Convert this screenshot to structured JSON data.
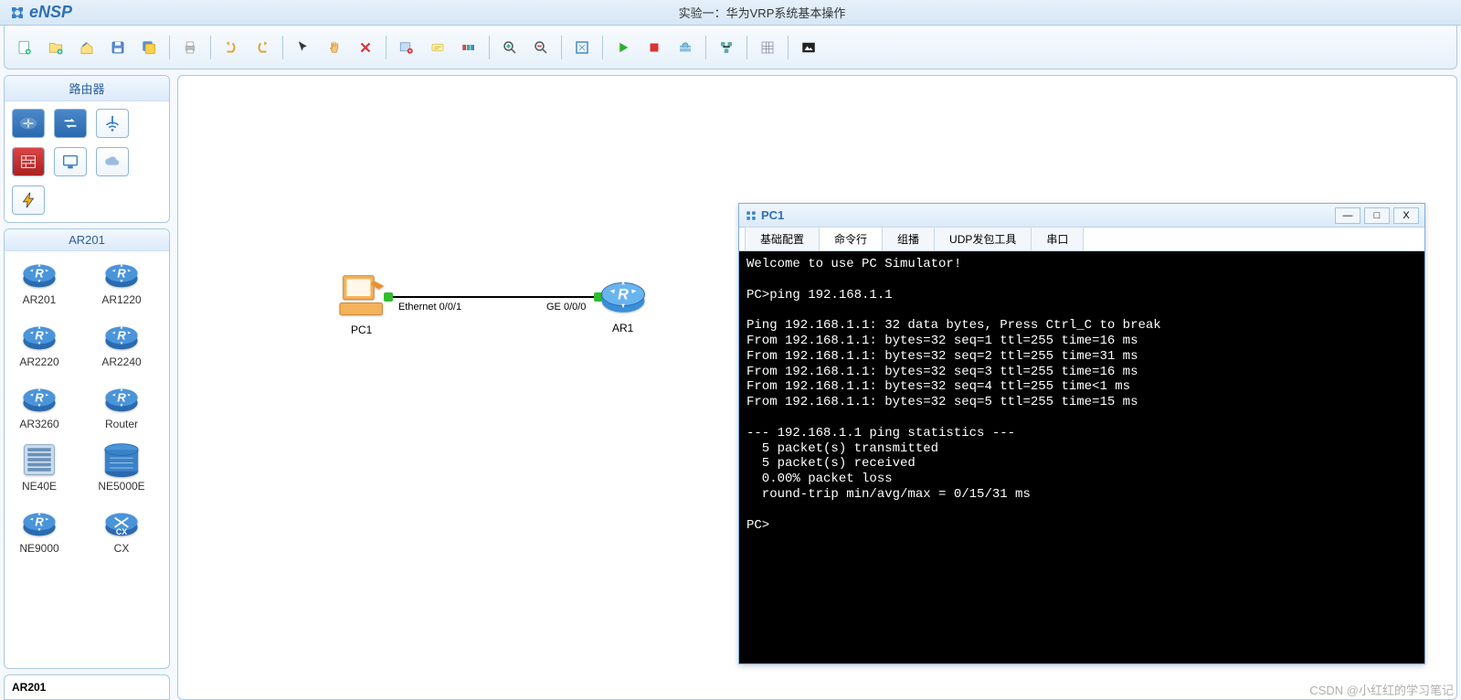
{
  "app": {
    "name": "eNSP",
    "document_title": "实验一：华为VRP系统基本操作"
  },
  "toolbar_icons": [
    "new",
    "open",
    "up",
    "save",
    "saveall",
    "export",
    "print",
    "undo",
    "redo",
    "select",
    "pan",
    "delete",
    "edit-device",
    "note",
    "zoom-area",
    "zoom-in",
    "zoom-out",
    "screenshot",
    "start",
    "stop",
    "capture",
    "settings",
    "grid",
    "theme"
  ],
  "sidebar": {
    "category_title": "路由器",
    "category_icons": [
      "router-cat",
      "switch-cat",
      "wlan-cat",
      "firewall-cat",
      "pc-cat",
      "cloud-cat",
      "lightning-cat"
    ],
    "group_title": "AR201",
    "devices": [
      {
        "label": "AR201",
        "icon": "router"
      },
      {
        "label": "AR1220",
        "icon": "router"
      },
      {
        "label": "AR2220",
        "icon": "router"
      },
      {
        "label": "AR2240",
        "icon": "router"
      },
      {
        "label": "AR3260",
        "icon": "router"
      },
      {
        "label": "Router",
        "icon": "router"
      },
      {
        "label": "NE40E",
        "icon": "ne40e"
      },
      {
        "label": "NE5000E",
        "icon": "ne5000e"
      },
      {
        "label": "NE9000",
        "icon": "router"
      },
      {
        "label": "CX",
        "icon": "cx"
      }
    ],
    "preview_label": "AR201"
  },
  "topology": {
    "pc_label": "PC1",
    "if_left": "Ethernet 0/0/1",
    "if_right": "GE 0/0/0",
    "router_label": "AR1"
  },
  "terminal": {
    "title": "PC1",
    "tabs": [
      "基础配置",
      "命令行",
      "组播",
      "UDP发包工具",
      "串口"
    ],
    "active_tab": 1,
    "output": "Welcome to use PC Simulator!\n\nPC>ping 192.168.1.1\n\nPing 192.168.1.1: 32 data bytes, Press Ctrl_C to break\nFrom 192.168.1.1: bytes=32 seq=1 ttl=255 time=16 ms\nFrom 192.168.1.1: bytes=32 seq=2 ttl=255 time=31 ms\nFrom 192.168.1.1: bytes=32 seq=3 ttl=255 time=16 ms\nFrom 192.168.1.1: bytes=32 seq=4 ttl=255 time<1 ms\nFrom 192.168.1.1: bytes=32 seq=5 ttl=255 time=15 ms\n\n--- 192.168.1.1 ping statistics ---\n  5 packet(s) transmitted\n  5 packet(s) received\n  0.00% packet loss\n  round-trip min/avg/max = 0/15/31 ms\n\nPC>"
  },
  "watermark": "CSDN @小红红的学习笔记"
}
